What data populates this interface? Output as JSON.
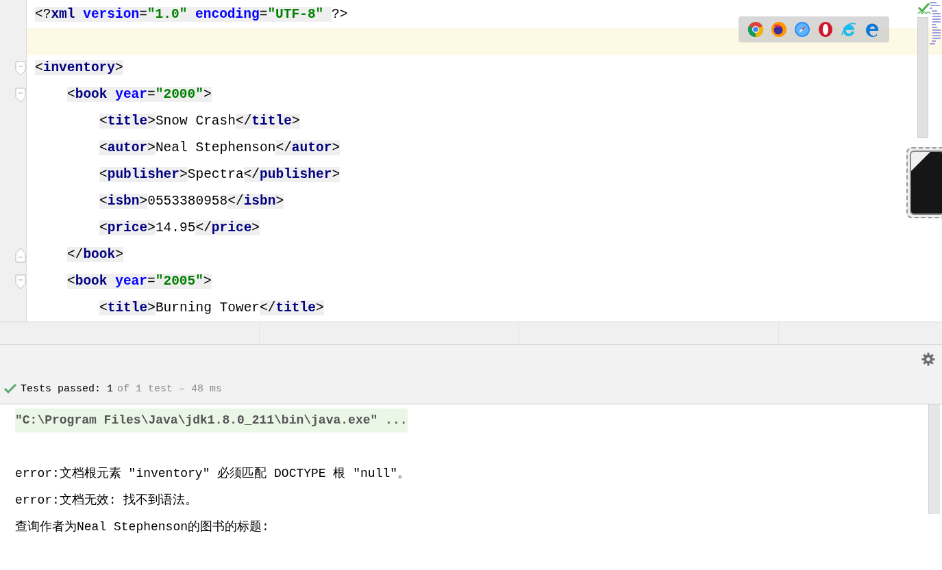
{
  "editor": {
    "lines": [
      {
        "kind": "plain",
        "current": false,
        "tokens": [
          {
            "kind": "punct",
            "text": "<?"
          },
          {
            "kind": "tag",
            "text": "xml"
          },
          {
            "kind": "attr",
            "text": " version"
          },
          {
            "kind": "punct",
            "text": "="
          },
          {
            "kind": "value",
            "text": "\"1.0\""
          },
          {
            "kind": "attr",
            "text": " encoding"
          },
          {
            "kind": "punct",
            "text": "="
          },
          {
            "kind": "value",
            "text": "\"UTF-8\" "
          },
          {
            "kind": "plain",
            "text": "?>"
          }
        ]
      },
      {
        "kind": "plain",
        "current": true
      },
      {
        "kind": "open",
        "current": false,
        "tokens": [
          {
            "kind": "punct",
            "text": "<"
          },
          {
            "kind": "tag",
            "text": "inventory"
          },
          {
            "kind": "punct",
            "text": ">"
          }
        ],
        "children": [
          {
            "kind": "open",
            "current": false,
            "tokens": [
              {
                "kind": "punct",
                "text": "<"
              },
              {
                "kind": "tag",
                "text": "book"
              },
              {
                "kind": "attr",
                "text": " year"
              },
              {
                "kind": "punct",
                "text": "="
              },
              {
                "kind": "value",
                "text": "\"2000\""
              },
              {
                "kind": "punct",
                "text": ">"
              }
            ],
            "children": [
              {
                "kind": "plain",
                "current": false,
                "tokens": [
                  {
                    "kind": "punct",
                    "text": "<"
                  },
                  {
                    "kind": "tag",
                    "text": "title"
                  },
                  {
                    "kind": "punct",
                    "text": ">"
                  },
                  {
                    "kind": "plain",
                    "text": "Snow Crash"
                  },
                  {
                    "kind": "punct",
                    "text": "</"
                  },
                  {
                    "kind": "tag",
                    "text": "title"
                  },
                  {
                    "kind": "punct",
                    "text": ">"
                  }
                ]
              },
              {
                "kind": "plain",
                "current": false,
                "tokens": [
                  {
                    "kind": "punct",
                    "text": "<"
                  },
                  {
                    "kind": "tag",
                    "text": "autor"
                  },
                  {
                    "kind": "punct",
                    "text": ">"
                  },
                  {
                    "kind": "plain",
                    "text": "Neal Stephenson"
                  },
                  {
                    "kind": "punct",
                    "text": "</"
                  },
                  {
                    "kind": "tag",
                    "text": "autor"
                  },
                  {
                    "kind": "punct",
                    "text": ">"
                  }
                ]
              },
              {
                "kind": "plain",
                "current": false,
                "tokens": [
                  {
                    "kind": "punct",
                    "text": "<"
                  },
                  {
                    "kind": "tag",
                    "text": "publisher"
                  },
                  {
                    "kind": "punct",
                    "text": ">"
                  },
                  {
                    "kind": "plain",
                    "text": "Spectra"
                  },
                  {
                    "kind": "punct",
                    "text": "</"
                  },
                  {
                    "kind": "tag",
                    "text": "publisher"
                  },
                  {
                    "kind": "punct",
                    "text": ">"
                  }
                ]
              },
              {
                "kind": "plain",
                "current": false,
                "tokens": [
                  {
                    "kind": "punct",
                    "text": "<"
                  },
                  {
                    "kind": "tag",
                    "text": "isbn"
                  },
                  {
                    "kind": "punct",
                    "text": ">"
                  },
                  {
                    "kind": "plain",
                    "text": "0553380958"
                  },
                  {
                    "kind": "punct",
                    "text": "</"
                  },
                  {
                    "kind": "tag",
                    "text": "isbn"
                  },
                  {
                    "kind": "punct",
                    "text": ">"
                  }
                ]
              },
              {
                "kind": "plain",
                "current": false,
                "tokens": [
                  {
                    "kind": "punct",
                    "text": "<"
                  },
                  {
                    "kind": "tag",
                    "text": "price"
                  },
                  {
                    "kind": "punct",
                    "text": ">"
                  },
                  {
                    "kind": "plain",
                    "text": "14.95"
                  },
                  {
                    "kind": "punct",
                    "text": "</"
                  },
                  {
                    "kind": "tag",
                    "text": "price"
                  },
                  {
                    "kind": "punct",
                    "text": ">"
                  }
                ]
              }
            ]
          },
          {
            "kind": "close",
            "current": false,
            "tokens": [
              {
                "kind": "punct",
                "text": "</"
              },
              {
                "kind": "tag",
                "text": "book"
              },
              {
                "kind": "punct",
                "text": ">"
              }
            ]
          },
          {
            "kind": "open",
            "current": false,
            "tokens": [
              {
                "kind": "punct",
                "text": "<"
              },
              {
                "kind": "tag",
                "text": "book"
              },
              {
                "kind": "attr",
                "text": " year"
              },
              {
                "kind": "punct",
                "text": "="
              },
              {
                "kind": "value",
                "text": "\"2005\""
              },
              {
                "kind": "punct",
                "text": ">"
              }
            ],
            "children": [
              {
                "kind": "plain",
                "current": false,
                "tokens": [
                  {
                    "kind": "punct",
                    "text": "<"
                  },
                  {
                    "kind": "tag",
                    "text": "title"
                  },
                  {
                    "kind": "punct",
                    "text": ">"
                  },
                  {
                    "kind": "plain",
                    "text": "Burning Tower"
                  },
                  {
                    "kind": "punct",
                    "text": "</"
                  },
                  {
                    "kind": "tag",
                    "text": "title"
                  },
                  {
                    "kind": "punct",
                    "text": ">"
                  }
                ]
              }
            ]
          }
        ]
      }
    ]
  },
  "browsers": [
    {
      "kind": "chrome"
    },
    {
      "kind": "firefox"
    },
    {
      "kind": "safari"
    },
    {
      "kind": "opera"
    },
    {
      "kind": "ie"
    },
    {
      "kind": "edge"
    }
  ],
  "status": {
    "label": "Tests passed:",
    "count": "1",
    "detail": "of 1 test – 48 ms"
  },
  "console": {
    "lines": [
      {
        "kind": "command",
        "text": "\"C:\\Program Files\\Java\\jdk1.8.0_211\\bin\\java.exe\" ..."
      },
      {
        "kind": "output",
        "text": "error:文档根元素 \"inventory\" 必须匹配 DOCTYPE 根 \"null\"。"
      },
      {
        "kind": "output",
        "text": "error:文档无效: 找不到语法。"
      },
      {
        "kind": "output",
        "text": "查询作者为Neal Stephenson的图书的标题:"
      }
    ]
  }
}
